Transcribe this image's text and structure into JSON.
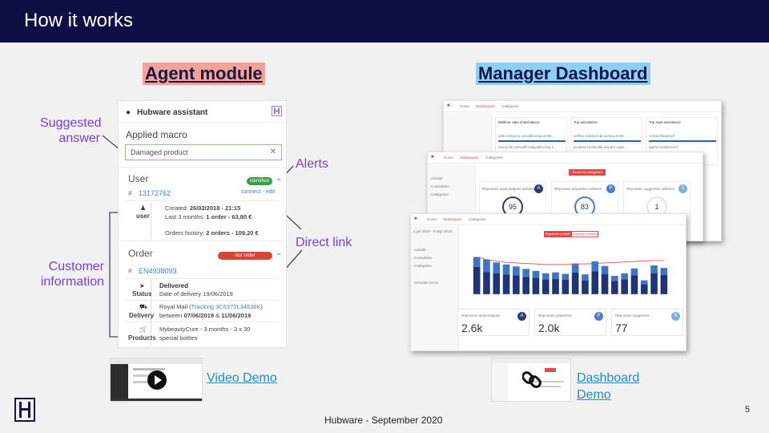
{
  "slide": {
    "title": "How it works",
    "footer": "Hubware - September 2020",
    "page_number": "5"
  },
  "agent_module": {
    "title": "Agent module",
    "annotations": {
      "suggested_answer": [
        "Suggested",
        "answer"
      ],
      "customer_information": [
        "Customer",
        "information"
      ],
      "alerts": "Alerts",
      "direct_link": "Direct link"
    },
    "card": {
      "header": "Hubware assistant",
      "applied_macro": "Applied macro",
      "macro_value": "Damaged product",
      "user_label": "User",
      "user_badge": "identified",
      "user_id": "13172762",
      "user_actions": "connect - edit",
      "user_icon_label": "user",
      "created_label": "Created: ",
      "created_value": "26/02/2018 - 21:15",
      "last3_label": "Last 3 months: ",
      "last3_value": "1 order - 63,80 €",
      "history_label": "Orders history: ",
      "history_value": "2 orders - 109,20 €",
      "order_label": "Order",
      "order_badge": "last order",
      "order_id": "EN4938093",
      "status_label": "Status",
      "status_title": "Delivered",
      "status_date": "Date of delivery 19/06/2019",
      "delivery_label": "Delivery",
      "delivery_carrier": "Royal Mail",
      "delivery_tracking": "Tracking 3C6372L34636K",
      "delivery_between": "between ",
      "delivery_from": "07/06/2019",
      "delivery_and": " & ",
      "delivery_to": "11/06/2019",
      "products_label": "Products",
      "products_line1": "MybeautyCure - 3 months - 3 x 30",
      "products_line2": "special bottles"
    },
    "video_demo": "Video Demo"
  },
  "manager_dashboard": {
    "title": "Manager Dashboard",
    "back": {
      "tabs": [
        "Home",
        "Statistiques",
        "Catégories"
      ],
      "cards": [
        {
          "title": "Meilleur ratio d'assistance",
          "rows": [
            "ashu.umgnou.ruroutilcompa.ensk...",
            "eansrollu.ssenoillf.naispuillm.bsp.n..."
          ]
        },
        {
          "title": "Top assistance",
          "rows": [
            "umflou.marsorrnat.sompa.ensk...",
            "produits.troidavilla.avipanr.ospe..."
          ]
        },
        {
          "title": "Top rejet assistance",
          "rows": [
            "roxlus.Ilteadey.fr",
            "agent.roudaurna.fr"
          ]
        }
      ]
    },
    "mid": {
      "tabs": [
        "Home",
        "Statistiques",
        "Catégories"
      ],
      "sidebar": [
        "Activité",
        "Consultées",
        "Catégories"
      ],
      "button": "Toutes les catégories",
      "gauges": [
        {
          "label": "Réponses automatiques utilisées",
          "badge": "A",
          "value": "95",
          "color": "#2a3a80"
        },
        {
          "label": "Réponses préparées utilisées",
          "badge": "P",
          "value": "83",
          "color": "#4a7ed1"
        },
        {
          "label": "Réponses suggérées utilisées",
          "badge": "S",
          "value": "1",
          "color": "#79aee8"
        }
      ]
    },
    "front": {
      "tabs": [
        "Home",
        "Statistiques",
        "Catégories"
      ],
      "date_range": "1 juil 2019 - 8 sept 2019",
      "sidebar": [
        "Activité",
        "Consultées",
        "Catégories"
      ],
      "sidebar_footer": "Semaine 20.01",
      "buttons": [
        "Réponses produit",
        "Réponses utilisées"
      ],
      "kpis": [
        {
          "label": "Réponses automatiques",
          "badge": "A",
          "value": "2.6k",
          "color": "#2a3a80"
        },
        {
          "label": "Réponses préparées",
          "badge": "P",
          "value": "2.0k",
          "color": "#4a7ed1"
        },
        {
          "label": "Réponses suggérées",
          "badge": "S",
          "value": "77",
          "color": "#79aee8"
        }
      ]
    },
    "dashboard_demo": [
      "Dashboard",
      "Demo"
    ]
  },
  "chart_data": {
    "type": "bar",
    "series": [
      {
        "name": "dark",
        "color": "#1f3475",
        "values": [
          55,
          45,
          42,
          40,
          38,
          35,
          33,
          30,
          31,
          29,
          44,
          28,
          46,
          41,
          27,
          30,
          38,
          20,
          42,
          39
        ]
      },
      {
        "name": "light",
        "color": "#3d74c8",
        "values": [
          20,
          25,
          22,
          20,
          18,
          16,
          14,
          12,
          13,
          12,
          18,
          12,
          20,
          16,
          10,
          12,
          14,
          8,
          16,
          14
        ]
      }
    ],
    "line": [
      75,
      70,
      67,
      64,
      63,
      62,
      61,
      60,
      60,
      60,
      61,
      61,
      62,
      63,
      64,
      65,
      66,
      67,
      68,
      68
    ],
    "ylim": [
      0,
      100
    ]
  }
}
